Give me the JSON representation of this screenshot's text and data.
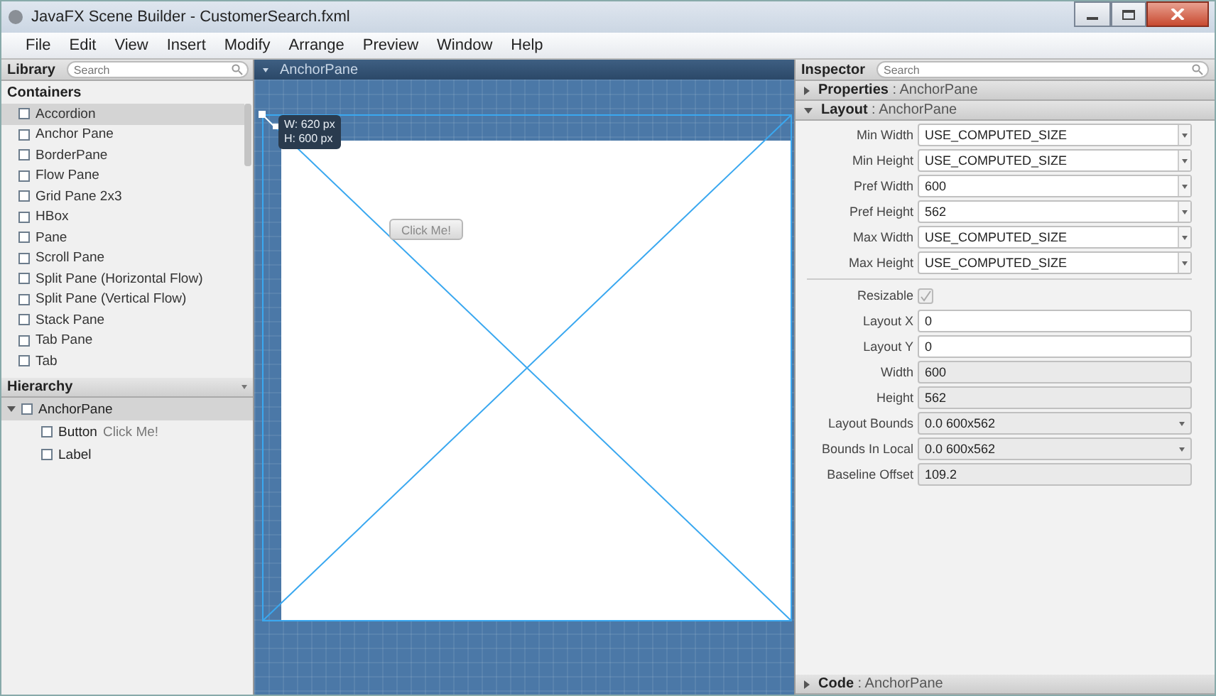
{
  "window": {
    "title": "JavaFX Scene Builder - CustomerSearch.fxml"
  },
  "menu": [
    "File",
    "Edit",
    "View",
    "Insert",
    "Modify",
    "Arrange",
    "Preview",
    "Window",
    "Help"
  ],
  "library": {
    "title": "Library",
    "search": {
      "placeholder": "Search"
    },
    "section": "Containers",
    "items": [
      {
        "label": "Accordion",
        "selected": true
      },
      {
        "label": "Anchor Pane",
        "selected": false
      },
      {
        "label": "BorderPane",
        "selected": false
      },
      {
        "label": "Flow Pane",
        "selected": false
      },
      {
        "label": "Grid Pane 2x3",
        "selected": false
      },
      {
        "label": "HBox",
        "selected": false
      },
      {
        "label": "Pane",
        "selected": false
      },
      {
        "label": "Scroll Pane",
        "selected": false
      },
      {
        "label": "Split Pane (Horizontal Flow)",
        "selected": false
      },
      {
        "label": "Split Pane (Vertical Flow)",
        "selected": false
      },
      {
        "label": "Stack Pane",
        "selected": false
      },
      {
        "label": "Tab Pane",
        "selected": false
      },
      {
        "label": "Tab",
        "selected": false
      }
    ]
  },
  "hierarchy": {
    "title": "Hierarchy",
    "items": [
      {
        "label": "AnchorPane",
        "selected": true,
        "expanded": true,
        "children": [
          {
            "label": "Button",
            "detail": "Click Me!",
            "selected": false
          },
          {
            "label": "Label",
            "selected": false
          }
        ]
      }
    ]
  },
  "canvas": {
    "header": "AnchorPane",
    "tooltip": [
      "W: 620 px",
      "H: 600 px"
    ],
    "button": "Click Me!"
  },
  "inspector": {
    "title": "Inspector",
    "search": {
      "placeholder": "Search"
    },
    "sections": [
      {
        "title": "Properties",
        "subject": ": AnchorPane",
        "expanded": false
      },
      {
        "title": "Layout",
        "subject": ": AnchorPane",
        "expanded": true
      }
    ],
    "rows": [
      {
        "kind": "combo",
        "label": "Min Width",
        "value": "USE_COMPUTED_SIZE"
      },
      {
        "kind": "combo",
        "label": "Min Height",
        "value": "USE_COMPUTED_SIZE"
      },
      {
        "kind": "combo",
        "label": "Pref Width",
        "value": "600"
      },
      {
        "kind": "combo",
        "label": "Pref Height",
        "value": "562"
      },
      {
        "kind": "combo",
        "label": "Max Width",
        "value": "USE_COMPUTED_SIZE"
      },
      {
        "kind": "combo",
        "label": "Max Height",
        "value": "USE_COMPUTED_SIZE"
      },
      {
        "kind": "separator"
      },
      {
        "kind": "check",
        "label": "Resizable",
        "checked": true,
        "disabled": true
      },
      {
        "kind": "text",
        "label": "Layout X",
        "value": "0"
      },
      {
        "kind": "text",
        "label": "Layout Y",
        "value": "0"
      },
      {
        "kind": "readonly",
        "label": "Width",
        "value": "600"
      },
      {
        "kind": "readonly",
        "label": "Height",
        "value": "562"
      },
      {
        "kind": "bounds",
        "label": "Layout Bounds",
        "value": "0.0  600x562"
      },
      {
        "kind": "bounds",
        "label": "Bounds In Local",
        "value": "0.0  600x562"
      },
      {
        "kind": "readonly",
        "label": "Baseline Offset",
        "value": "109.2"
      }
    ],
    "footer": {
      "title": "Code",
      "subject": ": AnchorPane",
      "expanded": false
    }
  }
}
